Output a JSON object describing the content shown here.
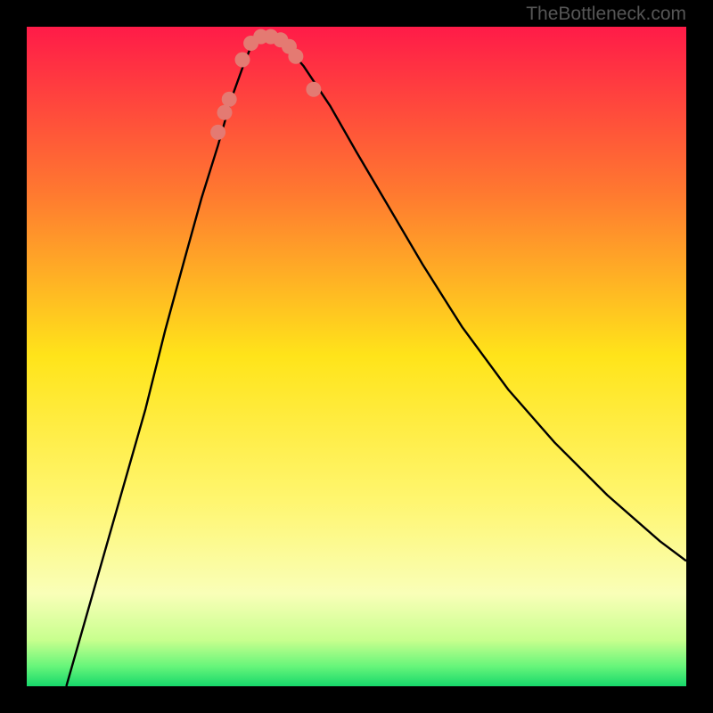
{
  "watermark": "TheBottleneck.com",
  "chart_data": {
    "type": "line",
    "title": "",
    "xlabel": "",
    "ylabel": "",
    "xlim": [
      0,
      100
    ],
    "ylim": [
      0,
      100
    ],
    "background": "heatmap_gradient_red_to_green",
    "gradient_stops": [
      {
        "offset": 0,
        "color": "#ff1b48"
      },
      {
        "offset": 25,
        "color": "#ff7830"
      },
      {
        "offset": 50,
        "color": "#ffe41a"
      },
      {
        "offset": 72,
        "color": "#fff670"
      },
      {
        "offset": 86,
        "color": "#f9ffb8"
      },
      {
        "offset": 93,
        "color": "#c8ff8e"
      },
      {
        "offset": 97,
        "color": "#66f57a"
      },
      {
        "offset": 100,
        "color": "#17d86b"
      }
    ],
    "series": [
      {
        "name": "bottleneck-curve",
        "style": "solid_black",
        "x": [
          6,
          10,
          14,
          18,
          21,
          24,
          26.5,
          29,
          31,
          32.8,
          34,
          35.5,
          37,
          39,
          42,
          46,
          50,
          55,
          60,
          66,
          73,
          80,
          88,
          96,
          100
        ],
        "y": [
          0,
          14,
          28,
          42,
          54,
          65,
          74,
          82,
          89,
          94,
          97,
          99,
          99,
          97.5,
          94,
          88,
          81,
          72.5,
          64,
          54.5,
          45,
          37,
          29,
          22,
          19
        ]
      }
    ],
    "markers": {
      "name": "highlight-dots",
      "color": "#e47a72",
      "points": [
        {
          "x": 29.0,
          "y": 84
        },
        {
          "x": 30.0,
          "y": 87
        },
        {
          "x": 30.7,
          "y": 89
        },
        {
          "x": 32.7,
          "y": 95
        },
        {
          "x": 34.0,
          "y": 97.5
        },
        {
          "x": 35.5,
          "y": 98.5
        },
        {
          "x": 37.0,
          "y": 98.5
        },
        {
          "x": 38.5,
          "y": 98
        },
        {
          "x": 39.8,
          "y": 97
        },
        {
          "x": 40.8,
          "y": 95.5
        },
        {
          "x": 43.5,
          "y": 90.5
        }
      ]
    }
  }
}
